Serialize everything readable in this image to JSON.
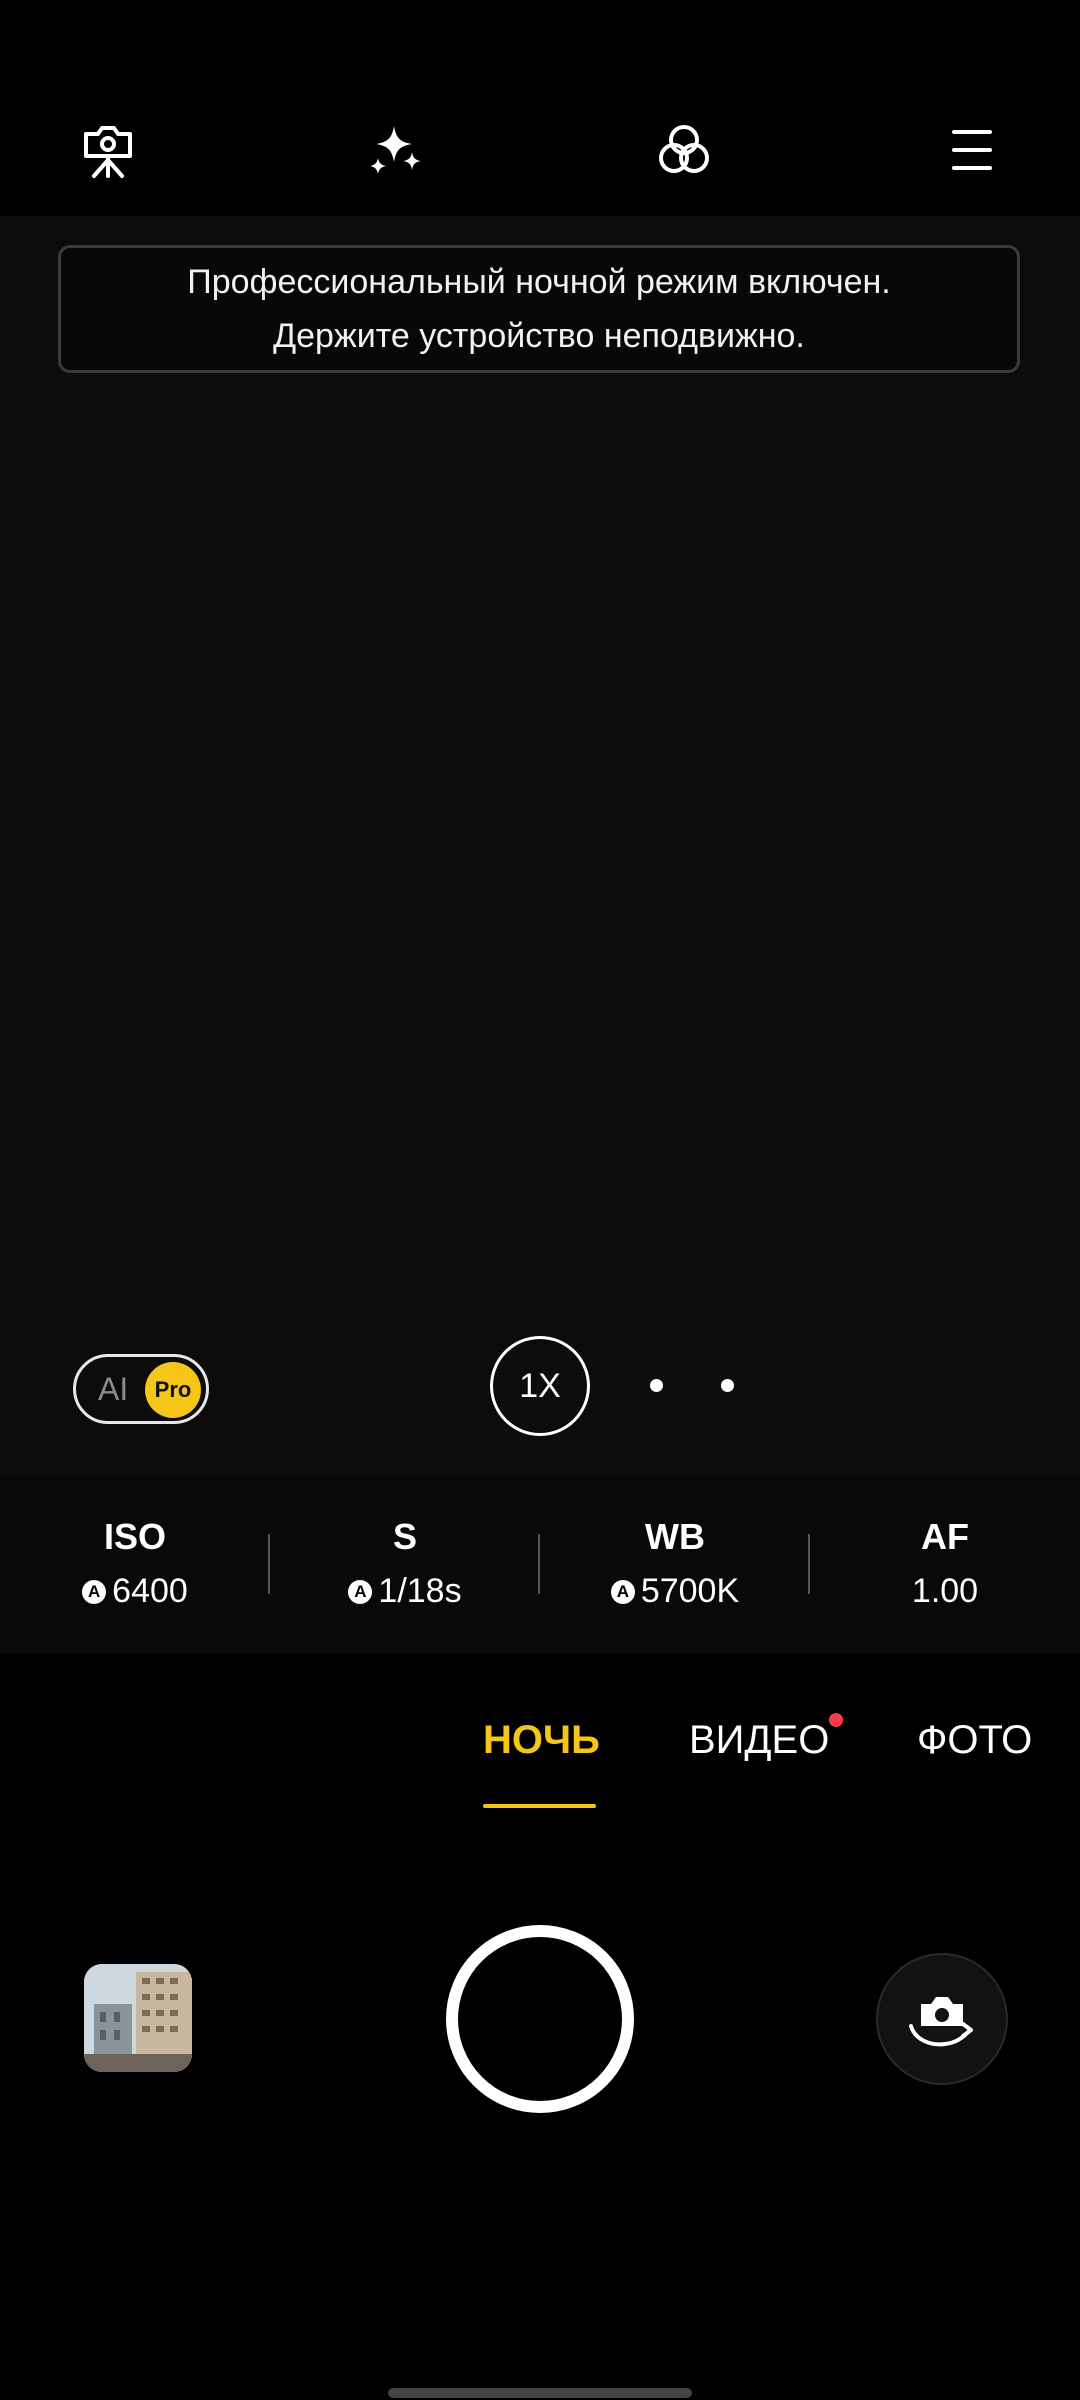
{
  "top_bar": {
    "icons": [
      "camera-tripod-icon",
      "sparkle-effects-icon",
      "color-filters-icon",
      "menu-icon"
    ]
  },
  "banner": {
    "line1": "Профессиональный ночной режим включен.",
    "line2": "Держите устройство неподвижно."
  },
  "ai_toggle": {
    "ai_label": "AI",
    "pro_label": "Pro"
  },
  "zoom": {
    "label": "1X"
  },
  "params": {
    "iso": {
      "name": "ISO",
      "value": "6400",
      "auto": "A"
    },
    "shutter": {
      "name": "S",
      "value": "1/18s",
      "auto": "A"
    },
    "wb": {
      "name": "WB",
      "value": "5700K",
      "auto": "A"
    },
    "af": {
      "name": "AF",
      "value": "1.00"
    }
  },
  "modes": {
    "night": "НОЧЬ",
    "video": "ВИДЕО",
    "photo": "ФОТО",
    "active": "night"
  },
  "colors": {
    "accent": "#f5c518",
    "notification": "#ff3b4a",
    "viewfinder": "#0d0b0b"
  }
}
